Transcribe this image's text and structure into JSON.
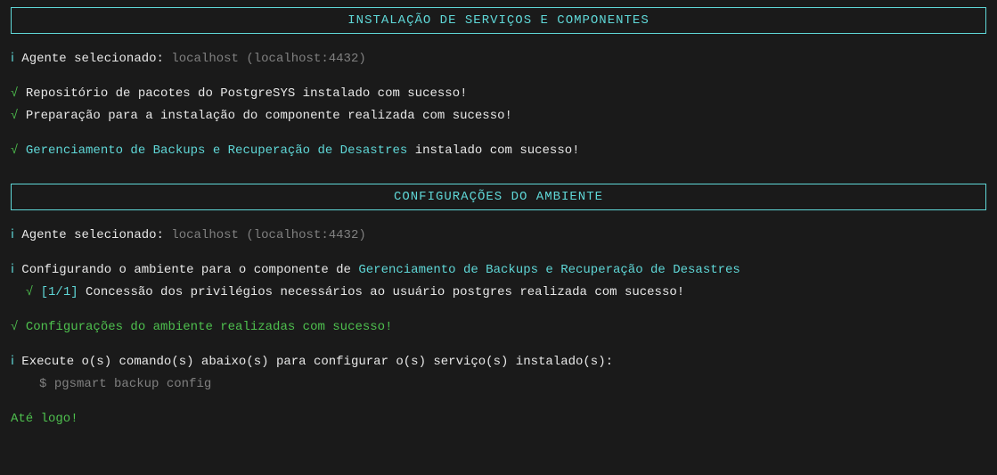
{
  "section1": {
    "title": "INSTALAÇÃO DE SERVIÇOS E COMPONENTES",
    "agent_label": "Agente selecionado: ",
    "agent_value": "localhost (localhost:4432)",
    "step1": "Repositório de pacotes do PostgreSYS instalado com sucesso!",
    "step2": "Preparação para a instalação do componente realizada com sucesso!",
    "component": "Gerenciamento de Backups e Recuperação de Desastres",
    "component_suffix": " instalado com sucesso!"
  },
  "section2": {
    "title": "CONFIGURAÇÕES DO AMBIENTE",
    "agent_label": "Agente selecionado: ",
    "agent_value": "localhost (localhost:4432)",
    "config_prefix": "Configurando o ambiente para o componente de ",
    "config_component": "Gerenciamento de Backups e Recuperação de Desastres",
    "progress": "[1/1]",
    "progress_text": " Concessão dos privilégios necessários ao usuário postgres realizada com sucesso!",
    "success": "Configurações do ambiente realizadas com sucesso!",
    "exec_label": "Execute o(s) comando(s) abaixo(s) para configurar o(s) serviço(s) instalado(s):",
    "cmd_prompt": "$ ",
    "cmd": "pgsmart backup config",
    "bye": "Até logo!"
  },
  "icons": {
    "info": "ⅰ",
    "check": "√"
  }
}
